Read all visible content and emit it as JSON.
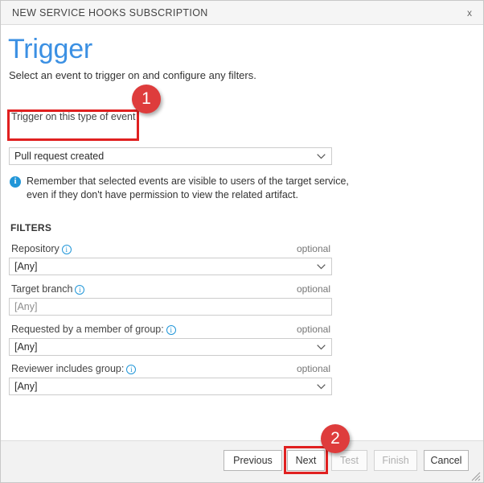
{
  "window": {
    "title": "NEW SERVICE HOOKS SUBSCRIPTION",
    "close_icon": "x"
  },
  "page": {
    "heading": "Trigger",
    "subheading": "Select an event to trigger on and configure any filters."
  },
  "trigger": {
    "label": "Trigger on this type of event",
    "value": "Pull request created",
    "chevron_icon": "chevron-down-icon"
  },
  "note": {
    "icon": "info-icon",
    "icon_glyph": "i",
    "text": "Remember that selected events are visible to users of the target service, even if they don't have permission to view the related artifact."
  },
  "filters": {
    "header": "FILTERS",
    "optional_label": "optional",
    "info_glyph": "i",
    "rows": [
      {
        "label": "Repository",
        "has_info": true,
        "optional": "optional",
        "control": "select",
        "value": "[Any]",
        "placeholder": false
      },
      {
        "label": "Target branch",
        "has_info": true,
        "optional": "optional",
        "control": "text",
        "value": "[Any]",
        "placeholder": true
      },
      {
        "label": "Requested by a member of group:",
        "has_info": true,
        "optional": "optional",
        "control": "select",
        "value": "[Any]",
        "placeholder": false
      },
      {
        "label": "Reviewer includes group:",
        "has_info": true,
        "optional": "optional",
        "control": "select",
        "value": "[Any]",
        "placeholder": false
      }
    ]
  },
  "footer": {
    "previous": "Previous",
    "next": "Next",
    "test": "Test",
    "finish": "Finish",
    "cancel": "Cancel",
    "disabled": [
      "Test",
      "Finish"
    ]
  },
  "callouts": [
    {
      "number": "1",
      "target": "trigger-event-field"
    },
    {
      "number": "2",
      "target": "next-button"
    }
  ],
  "colors": {
    "accent_blue": "#3b90e3",
    "callout_red": "#de3c3c",
    "highlight_red": "#e02020",
    "info_blue": "#2196d8",
    "footer_bg": "#f2f2f2",
    "titlebar_bg": "#f5f5f5"
  }
}
